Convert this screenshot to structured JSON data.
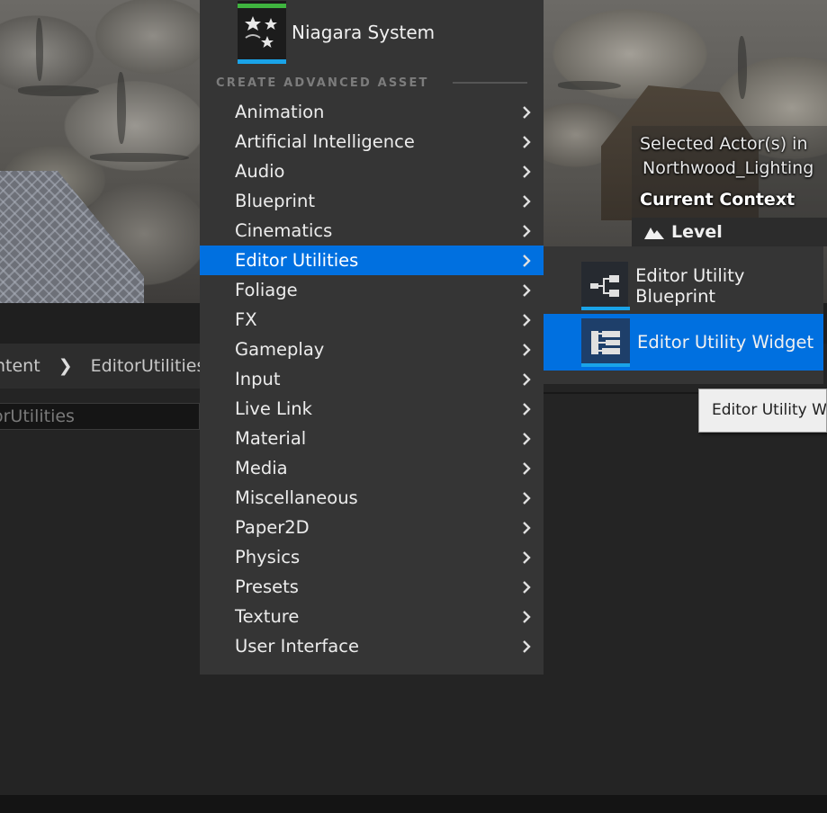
{
  "viewport": {
    "selected_actors_line1": "Selected Actor(s) in",
    "selected_actors_line2": "Northwood_Lighting",
    "current_context_label": "Current Context",
    "level_label": "Level"
  },
  "content_browser": {
    "breadcrumb": [
      "ntent",
      "EditorUtilities"
    ],
    "path_field_text": "orUtilities"
  },
  "menu": {
    "pinned_asset": {
      "label": "Niagara System",
      "icon": "niagara-sparkle-icon"
    },
    "section_header": "CREATE ADVANCED ASSET",
    "items": [
      {
        "label": "Animation"
      },
      {
        "label": "Artificial Intelligence"
      },
      {
        "label": "Audio"
      },
      {
        "label": "Blueprint"
      },
      {
        "label": "Cinematics"
      },
      {
        "label": "Editor Utilities",
        "active": true
      },
      {
        "label": "Foliage"
      },
      {
        "label": "FX"
      },
      {
        "label": "Gameplay"
      },
      {
        "label": "Input"
      },
      {
        "label": "Live Link"
      },
      {
        "label": "Material"
      },
      {
        "label": "Media"
      },
      {
        "label": "Miscellaneous"
      },
      {
        "label": "Paper2D"
      },
      {
        "label": "Physics"
      },
      {
        "label": "Presets"
      },
      {
        "label": "Texture"
      },
      {
        "label": "User Interface"
      }
    ]
  },
  "submenu": {
    "items": [
      {
        "label": "Editor Utility Blueprint",
        "icon": "blueprint-graph-icon"
      },
      {
        "label": "Editor Utility Widget",
        "icon": "widget-layout-icon",
        "active": true
      }
    ]
  },
  "tooltip": {
    "text": "Editor Utility Wic"
  },
  "colors": {
    "menu_bg": "#353535",
    "highlight": "#0070e0",
    "asset_underline": "#1aa3e8",
    "niagara_topline": "#3fb43f"
  }
}
